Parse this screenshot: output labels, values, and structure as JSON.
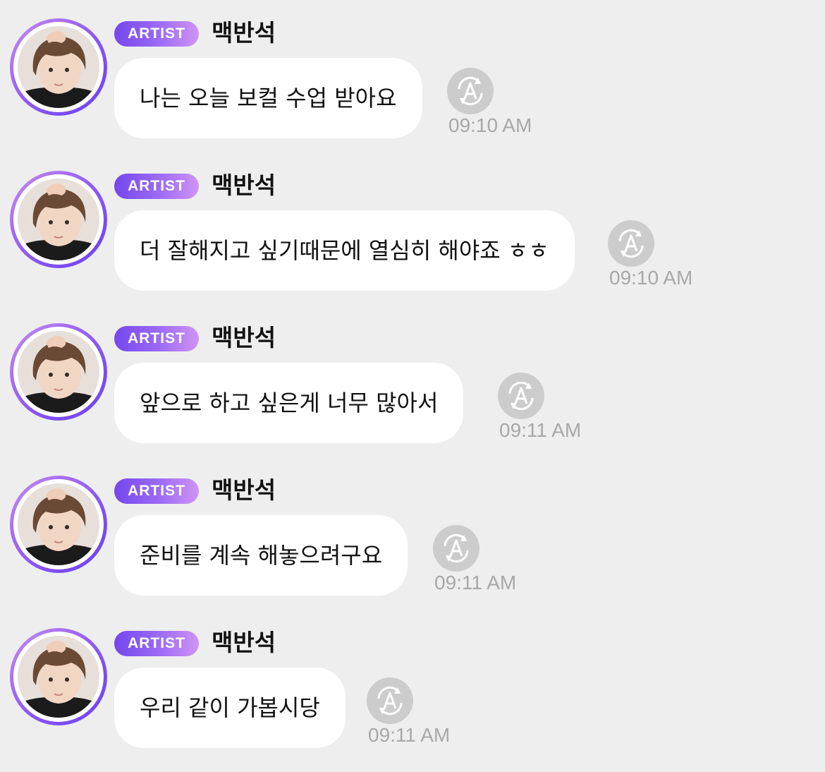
{
  "messages": [
    {
      "badge": "ARTIST",
      "author": "맥반석",
      "text": "나는 오늘 보컬 수업 받아요",
      "time": "09:10 AM",
      "read_icon": "auto-translate-icon"
    },
    {
      "badge": "ARTIST",
      "author": "맥반석",
      "text": "더 잘해지고 싶기때문에 열심히 해야죠 ㅎㅎ",
      "time": "09:10 AM",
      "read_icon": "auto-translate-icon"
    },
    {
      "badge": "ARTIST",
      "author": "맥반석",
      "text": "앞으로 하고 싶은게 너무 많아서",
      "time": "09:11 AM",
      "read_icon": "auto-translate-icon"
    },
    {
      "badge": "ARTIST",
      "author": "맥반석",
      "text": "준비를 계속 해놓으려구요",
      "time": "09:11 AM",
      "read_icon": "auto-translate-icon"
    },
    {
      "badge": "ARTIST",
      "author": "맥반석",
      "text": "우리 같이 가봅시당",
      "time": "09:11 AM",
      "read_icon": "auto-translate-icon"
    }
  ],
  "colors": {
    "background": "#eeeeee",
    "bubble": "#ffffff",
    "badge_gradient": [
      "#7447ee",
      "#cf94f4"
    ],
    "avatar_ring": [
      "#c98bf0",
      "#6b3ff0"
    ],
    "timestamp": "#a8a8a8",
    "icon": "#c8c8c8"
  }
}
